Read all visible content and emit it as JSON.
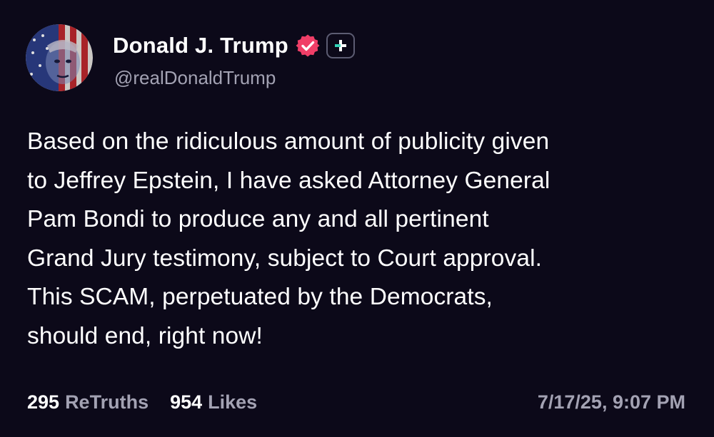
{
  "author": {
    "display_name": "Donald J. Trump",
    "handle": "@realDonaldTrump",
    "verified": true,
    "verified_color": "#f03e67"
  },
  "icons": {
    "verified": "verified-badge-icon",
    "follow": "plus-icon",
    "follow_accent": "#33d1b6"
  },
  "post": {
    "lines": [
      "Based on the ridiculous amount of publicity given",
      "to Jeffrey Epstein, I have asked Attorney General",
      "Pam Bondi to produce any and all pertinent",
      "Grand Jury testimony, subject to Court approval.",
      "This SCAM, perpetuated by the Democrats,",
      "should end, right now!"
    ]
  },
  "stats": {
    "retruths_count": "295",
    "retruths_label": "ReTruths",
    "likes_count": "954",
    "likes_label": "Likes"
  },
  "timestamp": "7/17/25, 9:07 PM",
  "colors": {
    "background": "#0c0919",
    "text": "#ffffff",
    "muted": "#a3a2b3"
  }
}
